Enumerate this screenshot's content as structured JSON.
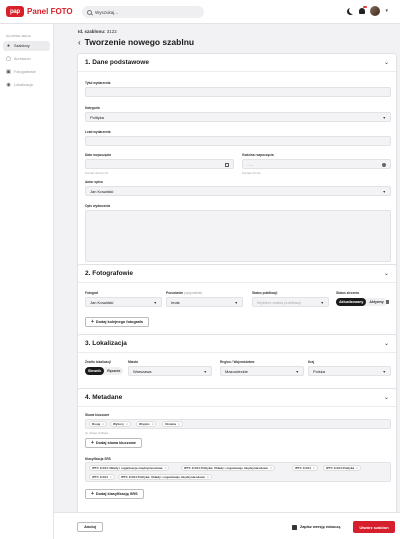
{
  "brand": {
    "badge": "pap",
    "name": "Panel FOTO",
    "color": "#d8202a"
  },
  "search": {
    "placeholder": "Wyszukaj..."
  },
  "sidebar": {
    "section_title": "GŁÓWNE MENU",
    "items": [
      {
        "label": "Szablony",
        "icon": "user-icon",
        "active": true
      },
      {
        "label": "Archiwum",
        "icon": "archive-icon"
      },
      {
        "label": "Fotografowie",
        "icon": "camera-icon"
      },
      {
        "label": "Lokalizacja",
        "icon": "pin-icon"
      }
    ]
  },
  "header": {
    "id_label": "Id. szablonu:",
    "id_value": "3122",
    "title": "Tworzenie nowego szablnu"
  },
  "basic": {
    "title": "1. Dane podstawowe",
    "title_label": "Tytuł wydarzenia",
    "category_label": "Kategoria",
    "category_value": "Polityka",
    "place_label": "Lead wydarzenia",
    "start_date_label": "Data rozpoczęcia",
    "start_date_hint": "Format: dd.mm.rrrr",
    "time_label": "Godzina rozpoczęcia",
    "time_placeholder": "--:--",
    "time_hint": "Format: hh:mm",
    "author_label": "Autor opisu",
    "author_value": "Jan Kowalski",
    "description_label": "Opis wydarzenia"
  },
  "photographers": {
    "title": "2. Fotografowie",
    "photographer_label": "Fotograf",
    "photographer_value": "Jan Kowalski",
    "sort_label": "Pseudonim",
    "sort_hint": "(opcjonalnie)",
    "sort_value": "Imak",
    "status_label": "Status publikacji",
    "status_placeholder": "Wybierz status publikacji",
    "work_status_label": "Status zlecenia",
    "seg_on": "Aktualizowany",
    "seg_off": "Aktywny",
    "add_label": "Dodaj kolejnego fotografa"
  },
  "location": {
    "title": "3. Lokalizacja",
    "source_label": "Źródło lokalizacji",
    "seg_on": "Słownik",
    "seg_off": "Ręcznie",
    "city_label": "Miasto",
    "city_value": "Warszawa",
    "region_label": "Region / Województwo",
    "region_value": "Mazowieckie",
    "country_label": "Kraj",
    "country_value": "Polska"
  },
  "metadata": {
    "title": "4. Metadane",
    "keywords_label": "Słowa kluczowe",
    "keywords": [
      "Rosja",
      "Wybory",
      "Wojsko",
      "Ukraina"
    ],
    "keywords_hint": "np. Rosja, Polityka",
    "add_keyword": "Dodaj słowa kluczowe",
    "srs_label": "Klasyfikacja SRS",
    "srs": [
      "IPTC 11014 Układy i organizacje międzynarodowe",
      "IPTC 11014 Polityka; Układy i organizacje międzynarodowe",
      "IPTC 11014",
      "IPTC 11014 Polityka",
      "IPTC 11014",
      "IPTC 11014 Polityka; Układy i organizacje międzynarodowe"
    ],
    "add_srs": "Dodaj klasyfikację SRS"
  },
  "footer": {
    "cancel": "Anuluj",
    "draft": "Zapisz wersję roboczą",
    "submit": "Utwórz szablon"
  }
}
